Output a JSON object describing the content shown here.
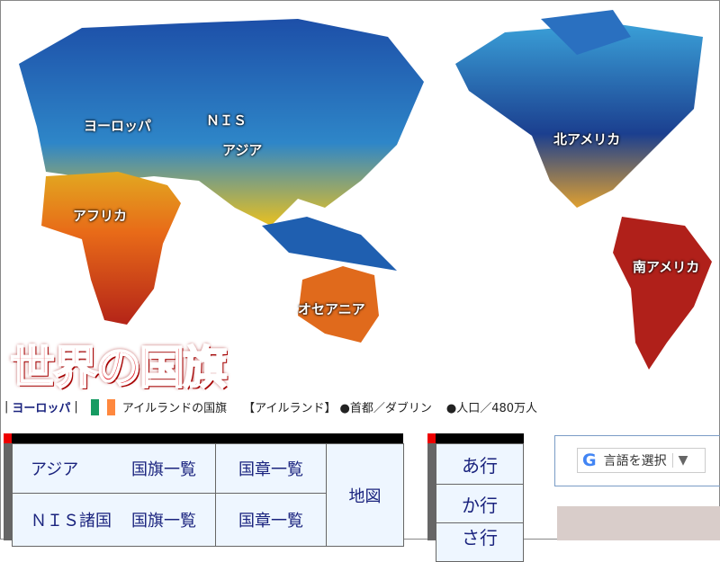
{
  "map": {
    "regions": [
      "ヨーロッパ",
      "ＮＩＳ",
      "アジア",
      "アフリカ",
      "オセアニア",
      "北アメリカ",
      "南アメリカ"
    ]
  },
  "site_title": "世界の国旗",
  "breadcrumb": {
    "region": "ヨーロッパ",
    "sep_left": "|",
    "sep_right": "|",
    "flag_caption": "アイルランドの国旗",
    "country": "【アイルランド】",
    "capital": "●首都／ダブリン",
    "population": "●人口／480万人",
    "flag_colors": [
      "#169b62",
      "#ffffff",
      "#ff883e"
    ]
  },
  "region_table": {
    "rows": [
      {
        "region": "アジア",
        "flags": "国旗一覧",
        "emblems": "国章一覧"
      },
      {
        "region": "ＮＩＳ諸国",
        "flags": "国旗一覧",
        "emblems": "国章一覧"
      }
    ],
    "map_link": "地図"
  },
  "kana_table": [
    "あ行",
    "か行",
    "さ行"
  ],
  "translate": {
    "label": "言語を選択",
    "arrow": "▼"
  }
}
